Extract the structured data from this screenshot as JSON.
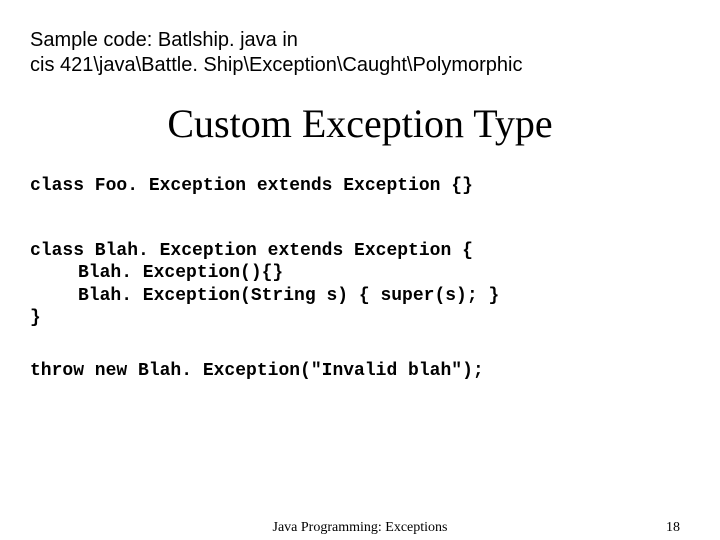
{
  "header": {
    "line1": "Sample code: Batlship. java in",
    "line2": "cis 421\\java\\Battle. Ship\\Exception\\Caught\\Polymorphic"
  },
  "title": "Custom Exception Type",
  "code": {
    "line1": "class Foo. Exception extends Exception {}",
    "line2": "class Blah. Exception extends Exception {",
    "line3": "Blah. Exception(){}",
    "line4": "Blah. Exception(String s) { super(s); }",
    "line5": "}",
    "line6": "throw new Blah. Exception(\"Invalid blah\");"
  },
  "footer": {
    "center": "Java Programming: Exceptions",
    "page": "18"
  }
}
